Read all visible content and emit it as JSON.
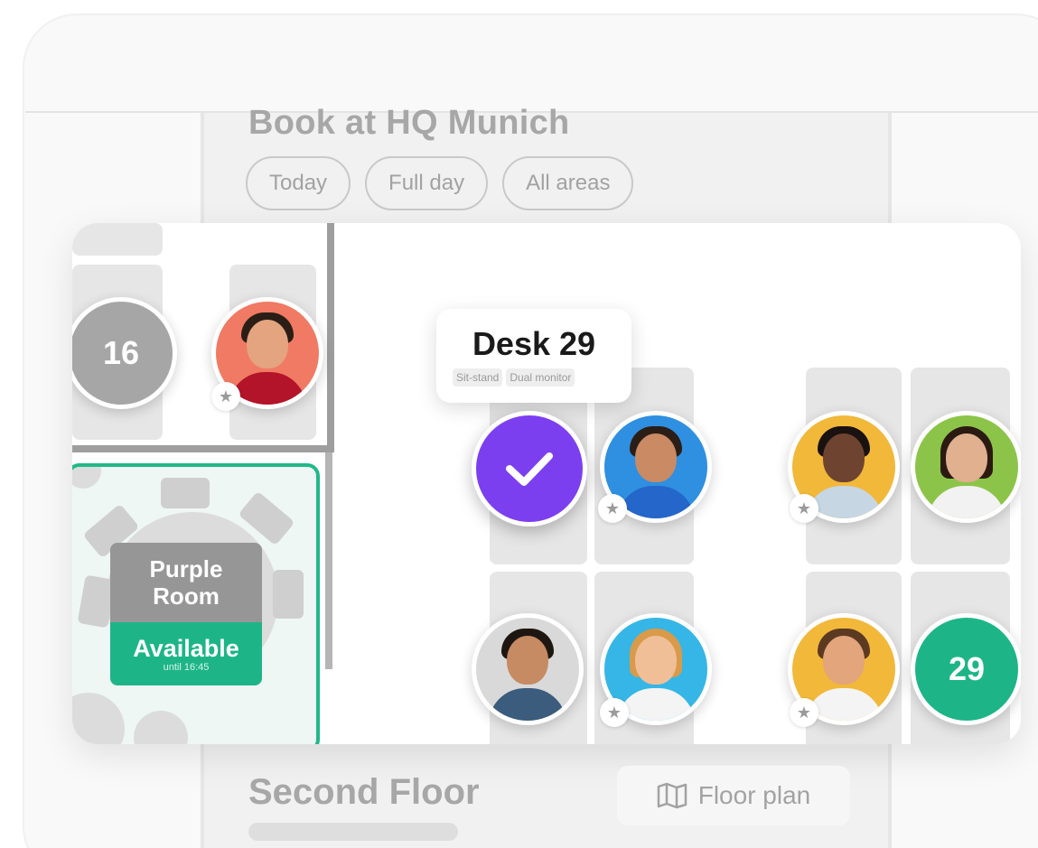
{
  "header": {
    "title": "Book at HQ Munich"
  },
  "filters": [
    {
      "label": "Today"
    },
    {
      "label": "Full day"
    },
    {
      "label": "All areas"
    }
  ],
  "map": {
    "seat_16": {
      "label": "16",
      "color": "#a6a6a6"
    },
    "seat_29": {
      "label": "29",
      "color": "#1db587"
    },
    "selected_seat_color": "#7c3ff0",
    "tooltip": {
      "title": "Desk 29",
      "tags": [
        "Sit-stand",
        "Dual monitor"
      ]
    },
    "meeting_room": {
      "name_line1": "Purple",
      "name_line2": "Room",
      "status": "Available",
      "until": "until 16:45",
      "accent": "#1db587"
    }
  },
  "floor": {
    "title": "Second Floor",
    "floor_plan_label": "Floor plan"
  },
  "icons": {
    "favorite": "star-icon",
    "check": "check-icon",
    "map": "map-icon"
  }
}
